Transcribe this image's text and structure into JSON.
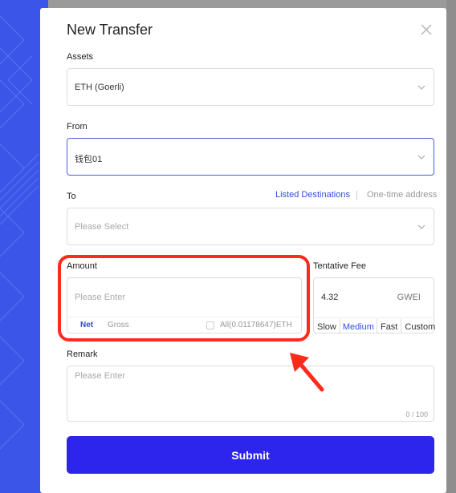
{
  "modal": {
    "title": "New Transfer",
    "assets": {
      "label": "Assets",
      "value": "ETH (Goerli)"
    },
    "from": {
      "label": "From",
      "value": "钱包01"
    },
    "to": {
      "label": "To",
      "listed_link": "Listed Destinations",
      "onetime_link": "One-time address",
      "placeholder": "Please Select"
    },
    "amount": {
      "label": "Amount",
      "placeholder": "Please Enter",
      "net": "Net",
      "gross": "Gross",
      "all_label": "All(0.01178647)ETH"
    },
    "fee": {
      "label": "Tentative Fee",
      "value": "4.32",
      "unit": "GWEI",
      "options": [
        "Slow",
        "Medium",
        "Fast",
        "Custom"
      ],
      "selected": "Medium"
    },
    "remark": {
      "label": "Remark",
      "placeholder": "Please Enter",
      "counter": "0 / 100"
    },
    "submit_label": "Submit"
  },
  "colors": {
    "accent": "#2d24ee",
    "link": "#2f4fd8",
    "annotation": "#ff2a1a"
  }
}
